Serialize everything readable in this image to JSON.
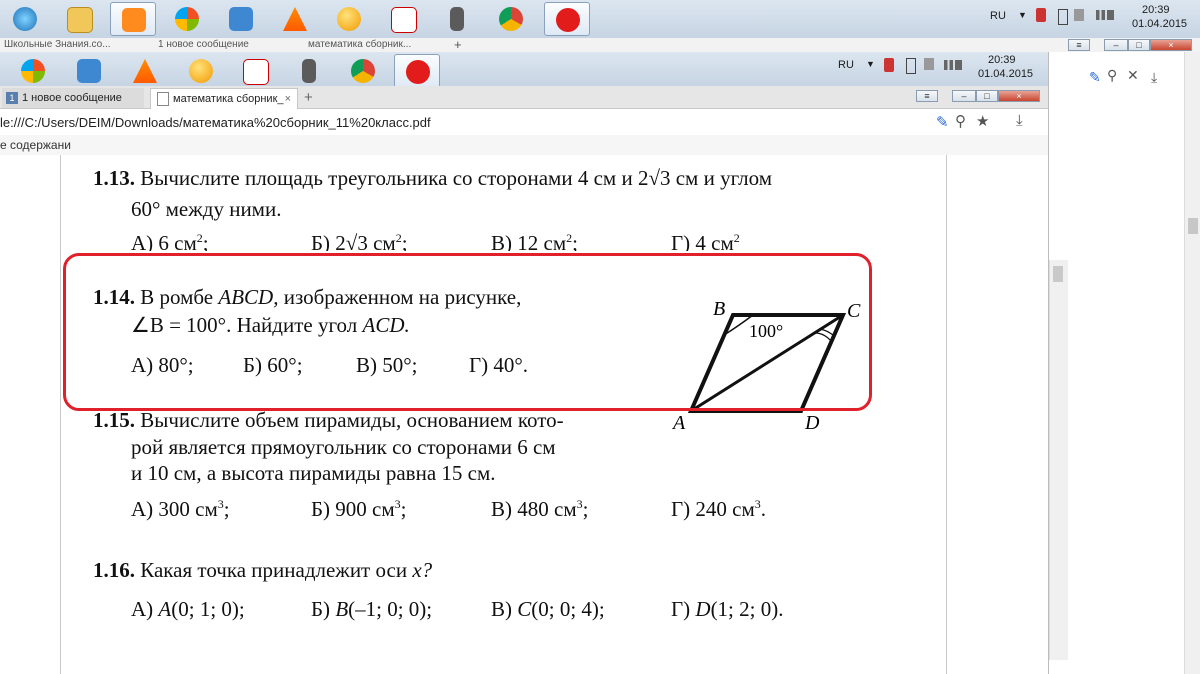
{
  "outer": {
    "taskbar": {
      "icons": [
        "windows-orb-icon",
        "explorer-folder-icon",
        "media-player-icon",
        "windows-flag-icon",
        "music-clef-icon",
        "vlc-cone-icon",
        "orange-ball-icon",
        "flash-f-icon",
        "counter-strike-icon",
        "chrome-icon",
        "yandex-y-icon"
      ],
      "lang": "RU",
      "time": "20:39",
      "date": "01.04.2015"
    },
    "tabs": [
      {
        "label": "Школьные Знания.со..."
      },
      {
        "label": "1 новое сообщение"
      },
      {
        "label": "математика сборник..."
      }
    ],
    "tab_add": "+"
  },
  "inner": {
    "taskbar": {
      "lang": "RU",
      "time": "20:39",
      "date": "01.04.2015"
    },
    "tabs": [
      {
        "badge": "1",
        "label": "1 новое сообщение"
      },
      {
        "label": "математика сборник_",
        "close": "×"
      }
    ],
    "tab_add": "+",
    "address": "le:///C:/Users/DEIM/Downloads/математика%20сборник_11%20класс.pdf",
    "bookmarks": "е содержани",
    "window_controls": {
      "menu": "≡",
      "minimize": "–",
      "maximize": "□",
      "close": "×"
    }
  },
  "problems": {
    "p13": {
      "num": "1.13.",
      "line1": "Вычислите площадь треугольника со сторонами 4 см и",
      "val1": "2√3",
      "line1b": "см и углом",
      "line2": "60° между ними.",
      "a": "А) 6 см",
      "b": "Б) 2√3  см",
      "c": "В) 12 см",
      "d": "Г) 4 см"
    },
    "p14": {
      "num": "1.14.",
      "line1": "В  ромбе",
      "abcd": "ABCD,",
      "line1b": "изображенном  на  рисунке,",
      "line2": "∠B = 100°.  Найдите угол",
      "acd": "ACD.",
      "a": "А) 80°;",
      "b": "Б) 60°;",
      "c": "В) 50°;",
      "d": "Г) 40°.",
      "fig": {
        "B": "B",
        "C": "C",
        "A": "A",
        "D": "D",
        "angle": "100°"
      }
    },
    "p15": {
      "num": "1.15.",
      "line1": "Вычислите объем пирамиды, основанием кото-",
      "line2": "рой является прямоугольник со сторонами 6 см",
      "line3": "и 10 см, а высота пирамиды равна 15 см.",
      "a": "А) 300 см",
      "b": "Б) 900 см",
      "c": "В) 480 см",
      "d": "Г) 240 см"
    },
    "p16": {
      "num": "1.16.",
      "line1": "Какая точка принадлежит оси",
      "x": "x?",
      "a": "А)",
      "a_pt": "A",
      "a_co": "(0; 1; 0);",
      "b": "Б)",
      "b_pt": "B",
      "b_co": "(–1; 0; 0);",
      "c": "В)",
      "c_pt": "C",
      "c_co": "(0; 0; 4);",
      "d": "Г)",
      "d_pt": "D",
      "d_co": "(1; 2; 0)."
    }
  },
  "colors": {
    "highlight": "#e0202a"
  }
}
